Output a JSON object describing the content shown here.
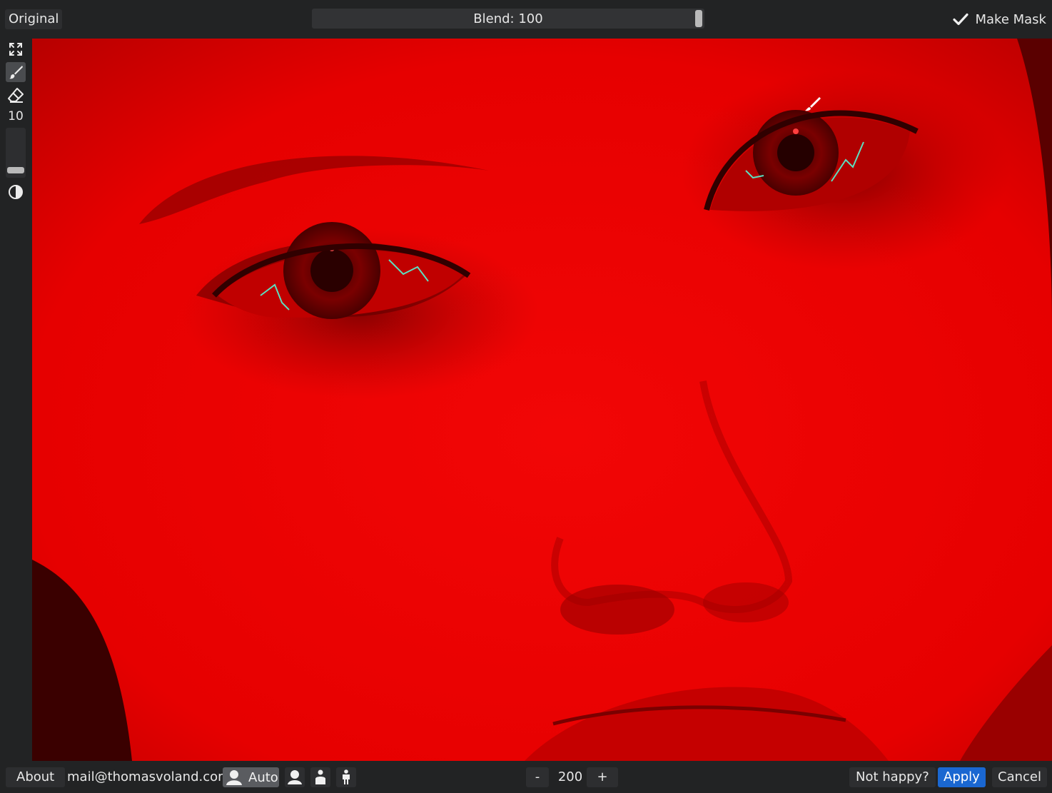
{
  "top": {
    "original_label": "Original",
    "blend_label": "Blend: 100",
    "blend_value_percent": 100,
    "make_mask_label": "Make Mask",
    "make_mask_checked": true
  },
  "tools": {
    "brush_size": "10",
    "icons": [
      "fullscreen-icon",
      "brush-icon",
      "eraser-icon",
      "invert-icon"
    ]
  },
  "bottom": {
    "about_label": "About",
    "email": "mail@thomasvoland.com",
    "auto_label": "Auto",
    "zoom_minus": "-",
    "zoom_value": "200",
    "zoom_plus": "+",
    "not_happy_label": "Not happy?",
    "apply_label": "Apply",
    "cancel_label": "Cancel"
  },
  "colors": {
    "accent": "#1a67d1",
    "mask_overlay": "#e60000",
    "background": "#222324"
  }
}
